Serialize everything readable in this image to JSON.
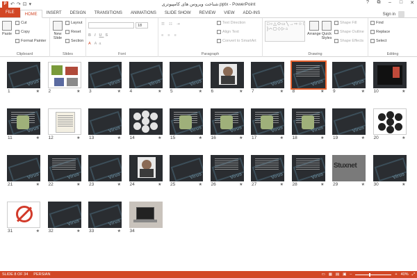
{
  "window": {
    "title": "شناخت ویروس های کامپیوتری.pptx - PowerPoint",
    "app_logo_text": "P",
    "qat": [
      "↶",
      "↷",
      "⊡",
      "▾"
    ],
    "controls": [
      "?",
      "⧉",
      "–",
      "□",
      "✕"
    ]
  },
  "tabs": [
    {
      "label": "FILE",
      "kind": "file"
    },
    {
      "label": "HOME",
      "kind": "active"
    },
    {
      "label": "INSERT",
      "kind": ""
    },
    {
      "label": "DESIGN",
      "kind": ""
    },
    {
      "label": "TRANSITIONS",
      "kind": ""
    },
    {
      "label": "ANIMATIONS",
      "kind": ""
    },
    {
      "label": "SLIDE SHOW",
      "kind": ""
    },
    {
      "label": "REVIEW",
      "kind": ""
    },
    {
      "label": "VIEW",
      "kind": ""
    },
    {
      "label": "ADD-INS",
      "kind": ""
    }
  ],
  "signin": "Sign in",
  "ribbon": {
    "clipboard": {
      "label": "Clipboard",
      "paste": "Paste",
      "cut": "Cut",
      "copy": "Copy",
      "format_painter": "Format Painter"
    },
    "slides": {
      "label": "Slides",
      "new_slide": "New Slide",
      "layout": "Layout",
      "reset": "Reset",
      "section": "Section"
    },
    "font": {
      "label": "Font",
      "size": "18"
    },
    "paragraph": {
      "label": "Paragraph",
      "text_direction": "Text Direction",
      "align_text": "Align Text",
      "convert_smartart": "Convert to SmartArt"
    },
    "drawing": {
      "label": "Drawing",
      "arrange": "Arrange",
      "quick_styles": "Quick Styles",
      "shape_fill": "Shape Fill",
      "shape_outline": "Shape Outline",
      "shape_effects": "Shape Effects",
      "shapes_glyphs": "□○△⬭▭╲→⇨☆⬡{ }⌒▢◇▷⌂"
    },
    "editing": {
      "label": "Editing",
      "find": "Find",
      "replace": "Replace",
      "select": "Select"
    }
  },
  "slides": [
    {
      "num": "1",
      "kind": "virus"
    },
    {
      "num": "2",
      "kind": "collage"
    },
    {
      "num": "3",
      "kind": "virus"
    },
    {
      "num": "4",
      "kind": "virus"
    },
    {
      "num": "5",
      "kind": "virus"
    },
    {
      "num": "6",
      "kind": "portrait"
    },
    {
      "num": "7",
      "kind": "virus"
    },
    {
      "num": "8",
      "kind": "text-selected"
    },
    {
      "num": "9",
      "kind": "virus"
    },
    {
      "num": "10",
      "kind": "dark-image"
    },
    {
      "num": "11",
      "kind": "text-image"
    },
    {
      "num": "12",
      "kind": "document"
    },
    {
      "num": "13",
      "kind": "virus"
    },
    {
      "num": "14",
      "kind": "circles"
    },
    {
      "num": "15",
      "kind": "text-image"
    },
    {
      "num": "16",
      "kind": "text-image"
    },
    {
      "num": "17",
      "kind": "text-image"
    },
    {
      "num": "18",
      "kind": "text-image"
    },
    {
      "num": "19",
      "kind": "virus"
    },
    {
      "num": "20",
      "kind": "white-circles"
    },
    {
      "num": "21",
      "kind": "virus"
    },
    {
      "num": "22",
      "kind": "text"
    },
    {
      "num": "23",
      "kind": "virus"
    },
    {
      "num": "24",
      "kind": "portrait"
    },
    {
      "num": "25",
      "kind": "virus"
    },
    {
      "num": "26",
      "kind": "text"
    },
    {
      "num": "27",
      "kind": "text"
    },
    {
      "num": "28",
      "kind": "text"
    },
    {
      "num": "29",
      "kind": "stuxnet"
    },
    {
      "num": "30",
      "kind": "virus"
    },
    {
      "num": "31",
      "kind": "nobug"
    },
    {
      "num": "32",
      "kind": "virus"
    },
    {
      "num": "33",
      "kind": "virus"
    },
    {
      "num": "34",
      "kind": "laptop"
    }
  ],
  "stuxnet_label": "Stuxnet",
  "star": "★",
  "statusbar": {
    "slide_of": "SLIDE 8 OF 34",
    "language": "PERSIAN",
    "zoom": "40%",
    "zoom_level": 0.4
  },
  "colors": {
    "accent": "#d24726",
    "selection": "#e8632f",
    "thumb_bg": "#2a2d31"
  }
}
